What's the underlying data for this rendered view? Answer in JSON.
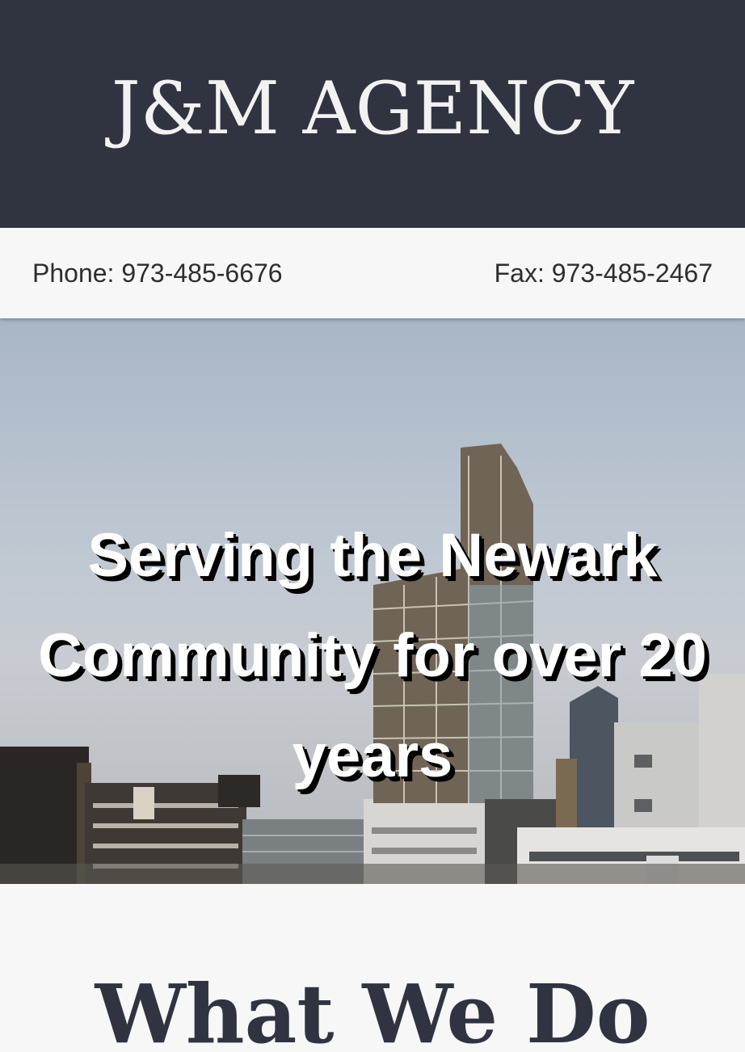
{
  "header": {
    "brand": "J&M AGENCY",
    "background_color": "#2f3440",
    "text_color": "#f2f2f2"
  },
  "contact": {
    "phone": "Phone: 973-485-6676",
    "fax": "Fax: 973-485-2467"
  },
  "hero": {
    "image": "newark-skyline-photo",
    "title": "Serving the Newark Community for over 20 years"
  },
  "section": {
    "heading": "What We Do"
  }
}
